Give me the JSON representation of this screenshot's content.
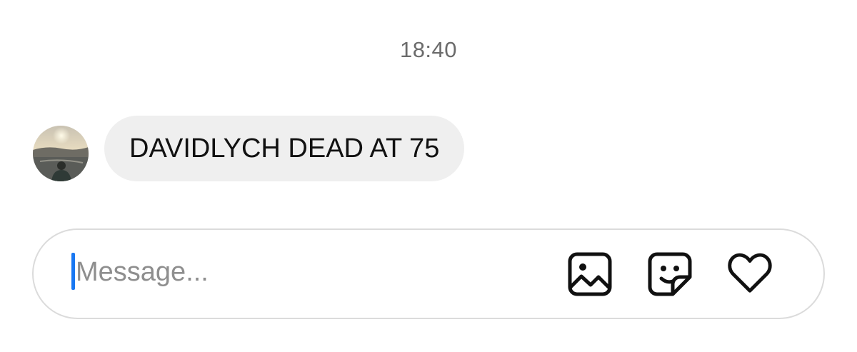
{
  "chat": {
    "timestamp": "18:40",
    "messages": [
      {
        "sender": "other",
        "text": "DAVIDLYCH DEAD AT 75"
      }
    ]
  },
  "composer": {
    "placeholder": "Message...",
    "value": "",
    "icons": [
      "image-icon",
      "sticker-icon",
      "heart-icon"
    ]
  },
  "colors": {
    "bubble_bg": "#efefef",
    "caret": "#1877f2",
    "border": "#dbdbdb",
    "timestamp": "#6b6b6b"
  }
}
